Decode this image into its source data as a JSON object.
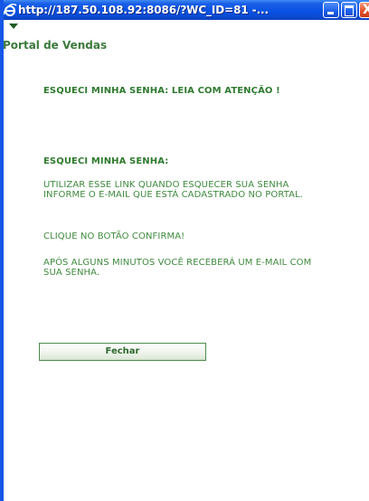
{
  "window": {
    "title": "http://187.50.108.92:8086/?WC_ID=81 -...",
    "controls": {
      "minimize": "minimize",
      "maximize": "maximize",
      "close": "X"
    },
    "colors": {
      "titlebar": "#0a52e2",
      "close_button": "#e2552e"
    }
  },
  "portal": {
    "title": "Portal de Vendas"
  },
  "content": {
    "heading_main": "ESQUECI MINHA SENHA: LEIA COM ATENÇÃO !",
    "heading_sub": "ESQUECI MINHA SENHA:",
    "paragraph_1": "UTILIZAR ESSE LINK QUANDO ESQUECER SUA SENHA INFORME O E-MAIL QUE ESTÁ CADASTRADO NO PORTAL.",
    "paragraph_2": "CLIQUE NO BOTÃO CONFIRMA!",
    "paragraph_3": "APÓS ALGUNS MINUTOS VOCÊ RECEBERÁ UM E-MAIL COM SUA SENHA.",
    "text_color": "#3f8a3f"
  },
  "actions": {
    "close_label": "Fechar"
  },
  "icons": {
    "title": "ie-browser-icon",
    "collapse": "triangle-down-icon"
  }
}
